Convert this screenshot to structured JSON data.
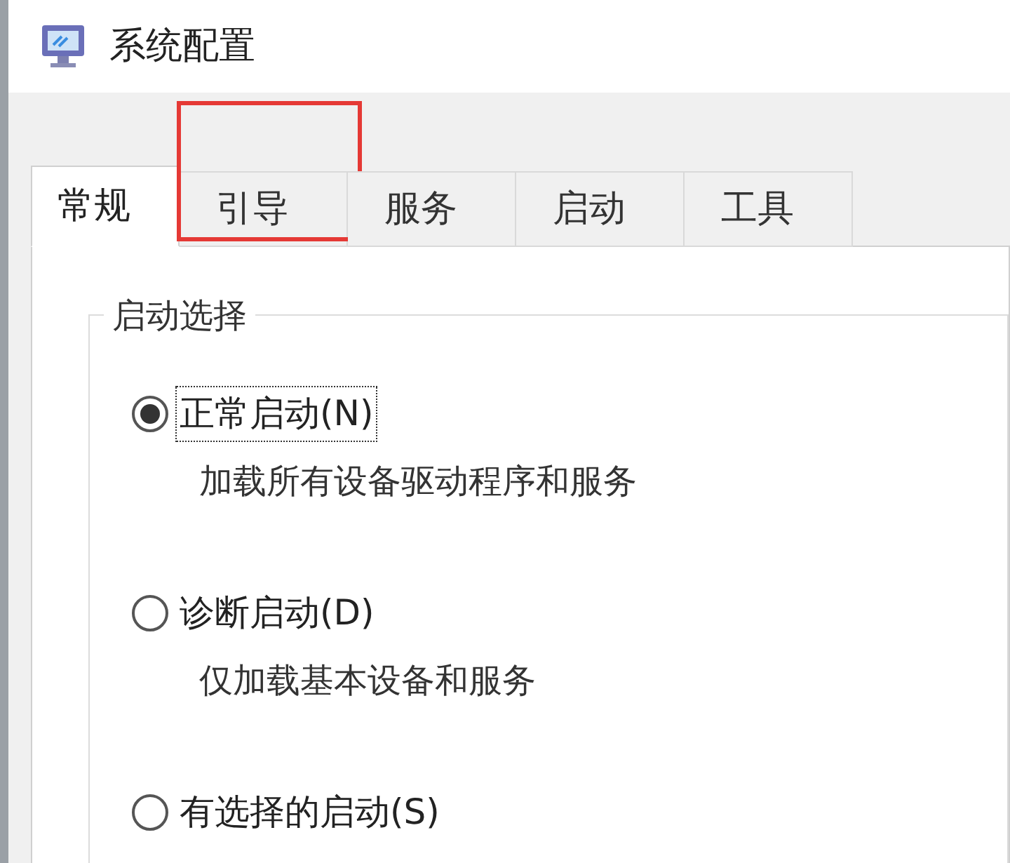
{
  "window": {
    "title": "系统配置"
  },
  "tabs": [
    {
      "label": "常规",
      "selected": true,
      "highlighted": false
    },
    {
      "label": "引导",
      "selected": false,
      "highlighted": true
    },
    {
      "label": "服务",
      "selected": false,
      "highlighted": false
    },
    {
      "label": "启动",
      "selected": false,
      "highlighted": false
    },
    {
      "label": "工具",
      "selected": false,
      "highlighted": false
    }
  ],
  "group": {
    "title": "启动选择",
    "options": [
      {
        "label": "正常启动(N)",
        "description": "加载所有设备驱动程序和服务",
        "selected": true
      },
      {
        "label": "诊断启动(D)",
        "description": "仅加载基本设备和服务",
        "selected": false
      },
      {
        "label": "有选择的启动(S)",
        "selected": false
      }
    ]
  }
}
